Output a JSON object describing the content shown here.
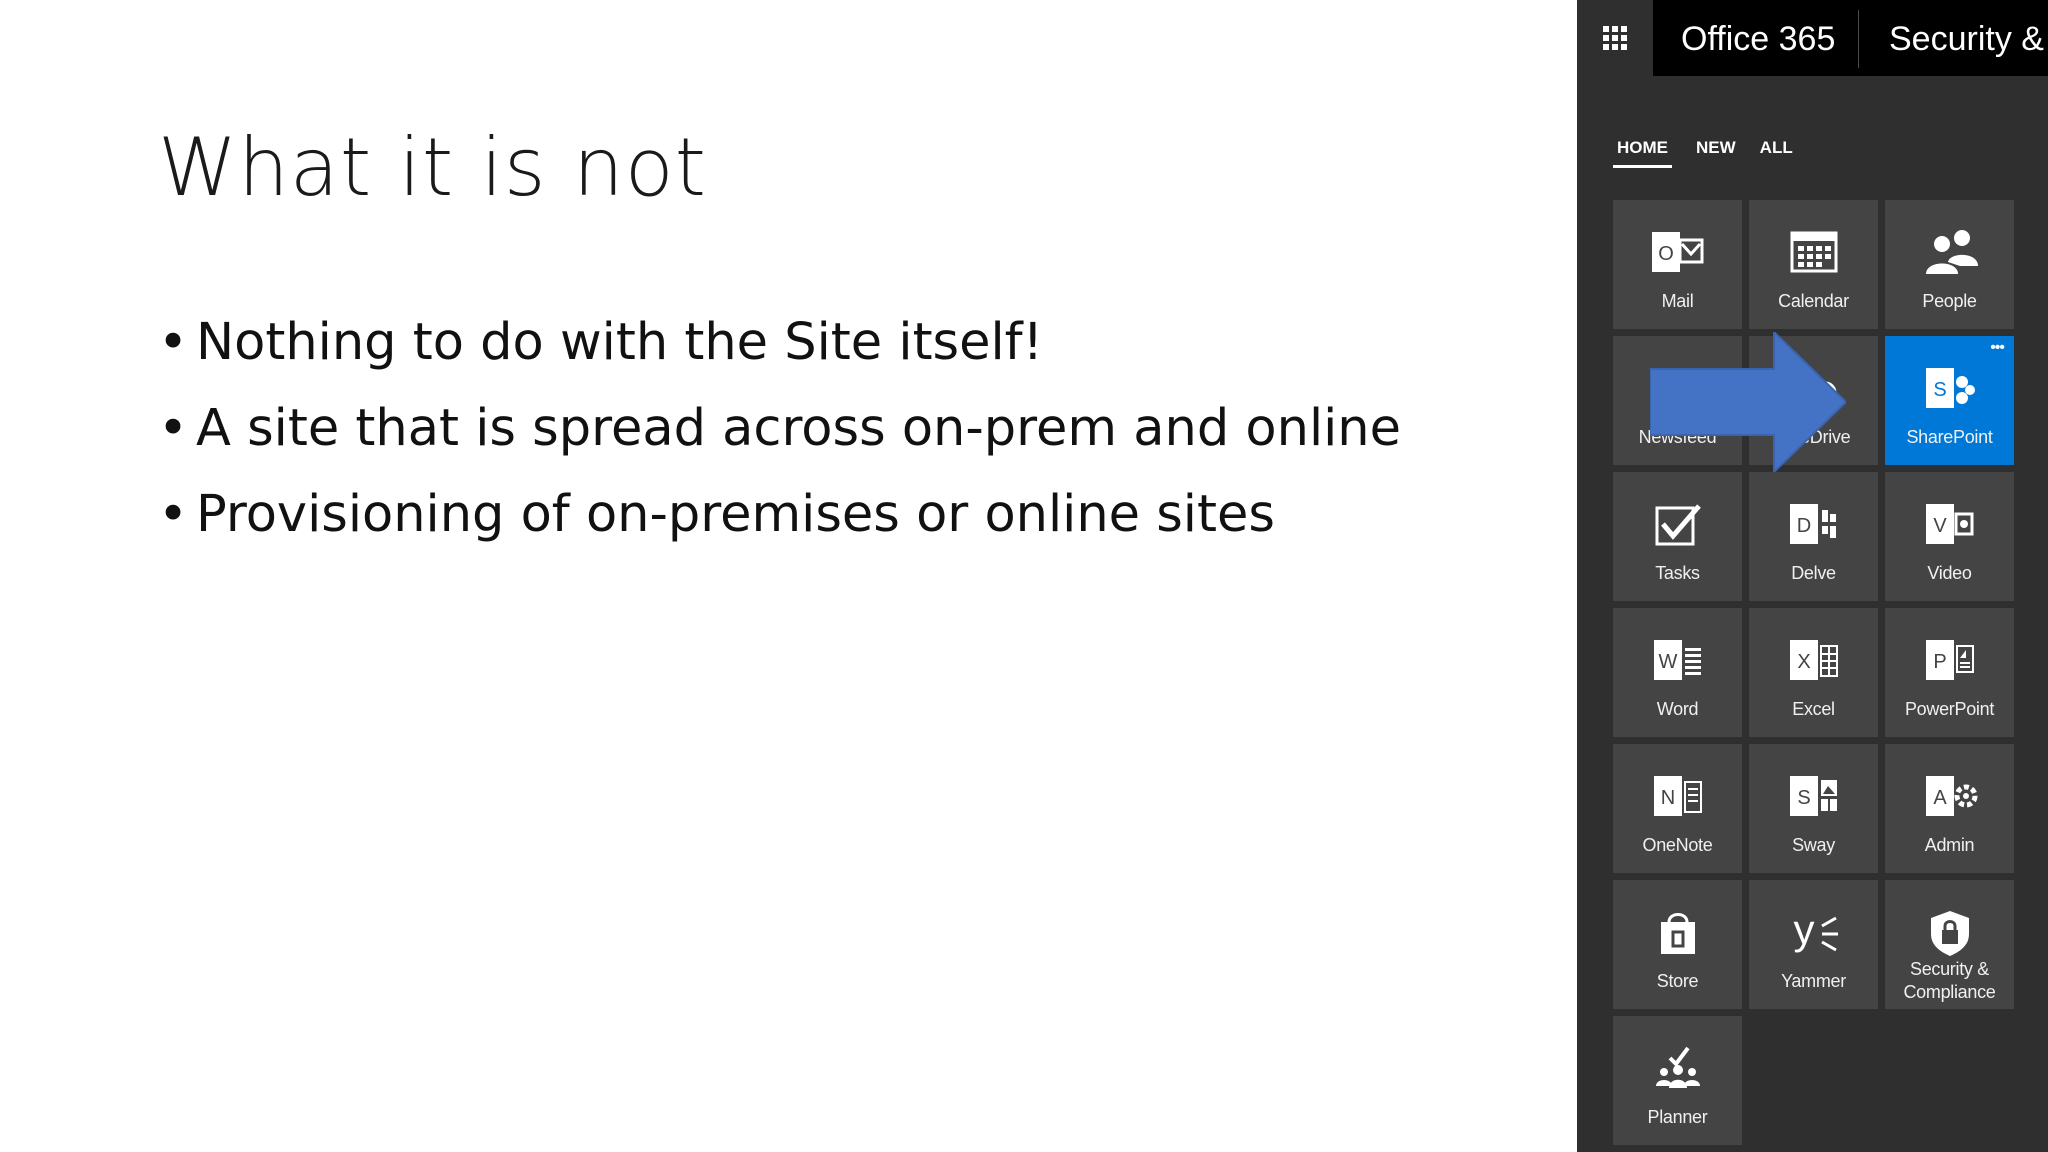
{
  "slide": {
    "title": "What it is not",
    "bullets": [
      "Nothing to do with the Site itself!",
      "A site that is spread across on-prem and online",
      "Provisioning of on-premises or online sites"
    ]
  },
  "launcher": {
    "brand": "Office 365",
    "app_title": "Security &",
    "tabs": [
      {
        "label": "HOME",
        "active": true
      },
      {
        "label": "NEW",
        "active": false
      },
      {
        "label": "ALL",
        "active": false
      }
    ],
    "tiles": [
      {
        "label": "Mail",
        "icon": "mail-icon"
      },
      {
        "label": "Calendar",
        "icon": "calendar-icon"
      },
      {
        "label": "People",
        "icon": "people-icon"
      },
      {
        "label": "Newsfeed",
        "icon": "newsfeed-icon"
      },
      {
        "label": "OneDrive",
        "icon": "onedrive-icon"
      },
      {
        "label": "SharePoint",
        "icon": "sharepoint-icon",
        "selected": true,
        "more": "•••"
      },
      {
        "label": "Tasks",
        "icon": "tasks-icon"
      },
      {
        "label": "Delve",
        "icon": "delve-icon"
      },
      {
        "label": "Video",
        "icon": "video-icon"
      },
      {
        "label": "Word",
        "icon": "word-icon"
      },
      {
        "label": "Excel",
        "icon": "excel-icon"
      },
      {
        "label": "PowerPoint",
        "icon": "powerpoint-icon"
      },
      {
        "label": "OneNote",
        "icon": "onenote-icon"
      },
      {
        "label": "Sway",
        "icon": "sway-icon"
      },
      {
        "label": "Admin",
        "icon": "admin-icon"
      },
      {
        "label": "Store",
        "icon": "store-icon"
      },
      {
        "label": "Yammer",
        "icon": "yammer-icon"
      },
      {
        "label": "Security & Compliance",
        "label_lines": [
          "Security &",
          "Compliance"
        ],
        "icon": "security-compliance-icon"
      },
      {
        "label": "Planner",
        "icon": "planner-icon"
      }
    ]
  },
  "colors": {
    "launcher_bg": "#2f2f2f",
    "tile_bg": "#444444",
    "selected_tile": "#0078d7",
    "arrow": "#4472c4"
  }
}
